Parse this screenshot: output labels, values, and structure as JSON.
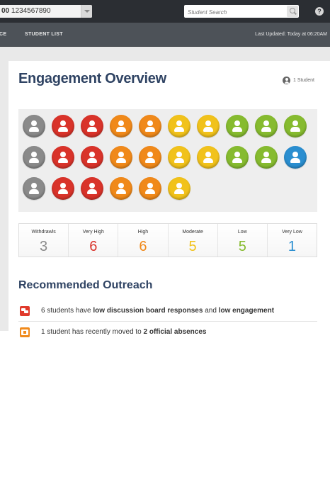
{
  "topbar": {
    "course_code": "00",
    "course_number": "1234567890",
    "search_placeholder": "Student Search",
    "help_glyph": "?"
  },
  "nav": {
    "cut_item": "CE",
    "student_list": "STUDENT LIST",
    "last_updated": "Last Updated: Today at 06:20AM"
  },
  "overview": {
    "title": "Engagement Overview",
    "student_count": "1 Student"
  },
  "colors": {
    "withdrawls": "#8a8a8a",
    "very_high": "#d9332a",
    "high": "#f0891a",
    "moderate": "#f1c21b",
    "low": "#86bb2f",
    "very_low": "#2a8ed0"
  },
  "dot_rows": [
    [
      "withdrawls",
      "very_high",
      "very_high",
      "high",
      "high",
      "moderate",
      "moderate",
      "low",
      "low",
      "low"
    ],
    [
      "withdrawls",
      "very_high",
      "very_high",
      "high",
      "high",
      "moderate",
      "moderate",
      "low",
      "low",
      "very_low"
    ],
    [
      "withdrawls",
      "very_high",
      "very_high",
      "high",
      "high",
      "moderate"
    ]
  ],
  "stats": [
    {
      "key": "withdrawls",
      "label": "Withdrawls",
      "value": "3"
    },
    {
      "key": "very_high",
      "label": "Very High",
      "value": "6"
    },
    {
      "key": "high",
      "label": "High",
      "value": "6"
    },
    {
      "key": "moderate",
      "label": "Moderate",
      "value": "5"
    },
    {
      "key": "low",
      "label": "Low",
      "value": "5"
    },
    {
      "key": "very_low",
      "label": "Very Low",
      "value": "1"
    }
  ],
  "outreach": {
    "title": "Recommended Outreach",
    "items": [
      {
        "icon": "chat-icon",
        "parts": [
          "6 students have ",
          "low discussion board responses",
          " and ",
          "low engagement"
        ]
      },
      {
        "icon": "calendar-icon",
        "parts": [
          "1 student has recently moved to ",
          "2 official absences",
          "",
          ""
        ]
      }
    ]
  }
}
